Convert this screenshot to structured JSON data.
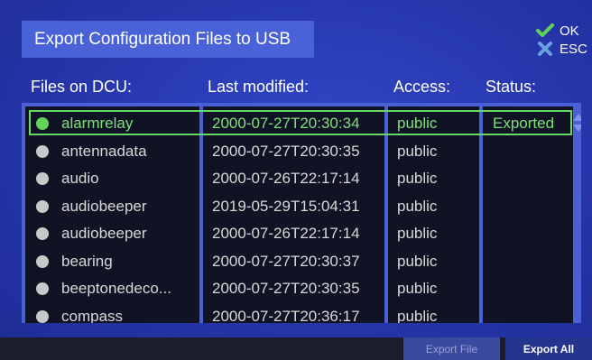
{
  "title": "Export Configuration Files to USB",
  "actions": {
    "ok_label": "OK",
    "esc_label": "ESC",
    "ok_icon": "check-icon",
    "esc_icon": "x-icon"
  },
  "columns": {
    "name": "Files on DCU:",
    "modified": "Last modified:",
    "access": "Access:",
    "status": "Status:"
  },
  "files": [
    {
      "name": "alarmrelay",
      "modified": "2000-07-27T20:30:34",
      "access": "public",
      "status": "Exported",
      "selected": true
    },
    {
      "name": "antennadata",
      "modified": "2000-07-27T20:30:35",
      "access": "public",
      "status": ""
    },
    {
      "name": "audio",
      "modified": "2000-07-26T22:17:14",
      "access": "public",
      "status": ""
    },
    {
      "name": "audiobeeper",
      "modified": "2019-05-29T15:04:31",
      "access": "public",
      "status": ""
    },
    {
      "name": "audiobeeper",
      "modified": "2000-07-26T22:17:14",
      "access": "public",
      "status": ""
    },
    {
      "name": "bearing",
      "modified": "2000-07-27T20:30:37",
      "access": "public",
      "status": ""
    },
    {
      "name": "beeptonedeco...",
      "modified": "2000-07-27T20:30:35",
      "access": "public",
      "status": ""
    },
    {
      "name": "compass",
      "modified": "2000-07-27T20:36:17",
      "access": "public",
      "status": ""
    }
  ],
  "buttons": {
    "export_file": "Export File",
    "export_all": "Export All"
  },
  "colors": {
    "background": "#2a3bb0",
    "selected_text": "#7fe07a",
    "selected_border": "#6bd86a",
    "ok_check": "#5fd35a",
    "esc_x": "#6aa0e0"
  }
}
